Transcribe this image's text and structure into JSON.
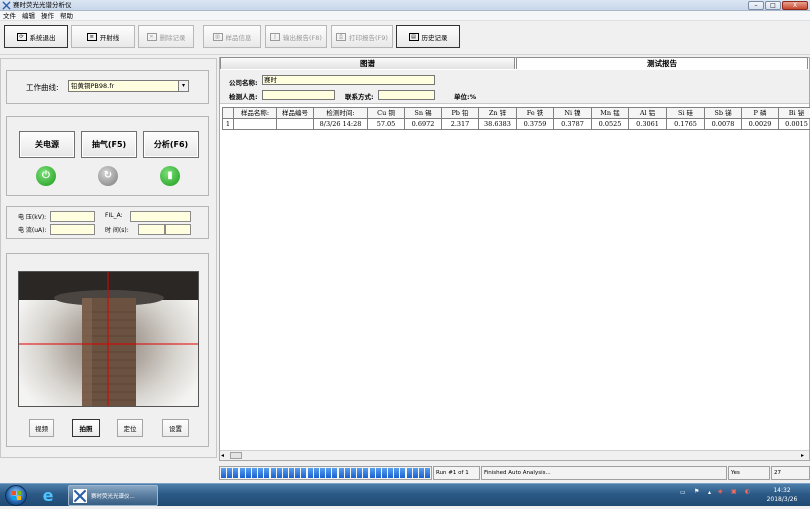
{
  "window": {
    "title": "赛时荧光光谱分析仪",
    "controls": [
      "–",
      "□",
      "X"
    ]
  },
  "menu": [
    "文件",
    "编辑",
    "操作",
    "帮助"
  ],
  "toolbar": [
    {
      "label": "系统退出",
      "icon": "exit-icon",
      "state": "active"
    },
    {
      "label": "开射线",
      "icon": "ray-icon",
      "state": "normal"
    },
    {
      "label": "删除记录",
      "icon": "delete-icon",
      "state": "disabled"
    },
    {
      "label": "样品信息",
      "icon": "sample-info-icon",
      "state": "disabled"
    },
    {
      "label": "输出报告(F8)",
      "icon": "export-icon",
      "state": "disabled"
    },
    {
      "label": "打印报告(F9)",
      "icon": "printer-icon",
      "state": "disabled"
    },
    {
      "label": "历史记录",
      "icon": "history-icon",
      "state": "active"
    }
  ],
  "left": {
    "curve_label": "工作曲线:",
    "curve_value": "铅黄铜PB98.fr",
    "buttons": {
      "power": "关电源",
      "pump": "抽气(F5)",
      "analyze": "分析(F6)"
    },
    "voltage_label": "电 压(kV):",
    "current_label": "电 流(uA):",
    "fil_label": "FIL_A:",
    "time_label": "时 间(s):",
    "camera_buttons": {
      "video": "视频",
      "photo": "拍照",
      "locate": "定位",
      "settings": "设置"
    }
  },
  "tabs": {
    "spectrum": "图谱",
    "report": "测试报告"
  },
  "report": {
    "company_label": "公司名称:",
    "company_value": "赛时",
    "inspector_label": "检测人员:",
    "contact_label": "联系方式:",
    "unit_label": "单位:%"
  },
  "table": {
    "headers": [
      "",
      "样品名称:",
      "样品编号",
      "检测时间:",
      "Cu 铜",
      "Sn 锡",
      "Pb 铅",
      "Zn 锌",
      "Fe 铁",
      "Ni 镍",
      "Mn 锰",
      "Al 铝",
      "Si 硅",
      "Sb 锑",
      "P 磷",
      "Bi 铋"
    ],
    "rows": [
      [
        "1",
        "",
        "",
        "8/3/26 14:28",
        "57.05",
        "0.6972",
        "2.317",
        "38.6383",
        "0.3759",
        "0.3787",
        "0.0525",
        "0.3061",
        "0.1765",
        "0.0078",
        "0.0029",
        "0.0015"
      ]
    ]
  },
  "status": {
    "run": "Run #1 of 1",
    "message": "Finished Auto Analysis...",
    "yes": "Yes",
    "count": "27",
    "progress": 1.0
  },
  "taskbar": {
    "app_label": "赛时荧光光谱仪...",
    "time": "14:32",
    "date": "2018/3/26"
  }
}
